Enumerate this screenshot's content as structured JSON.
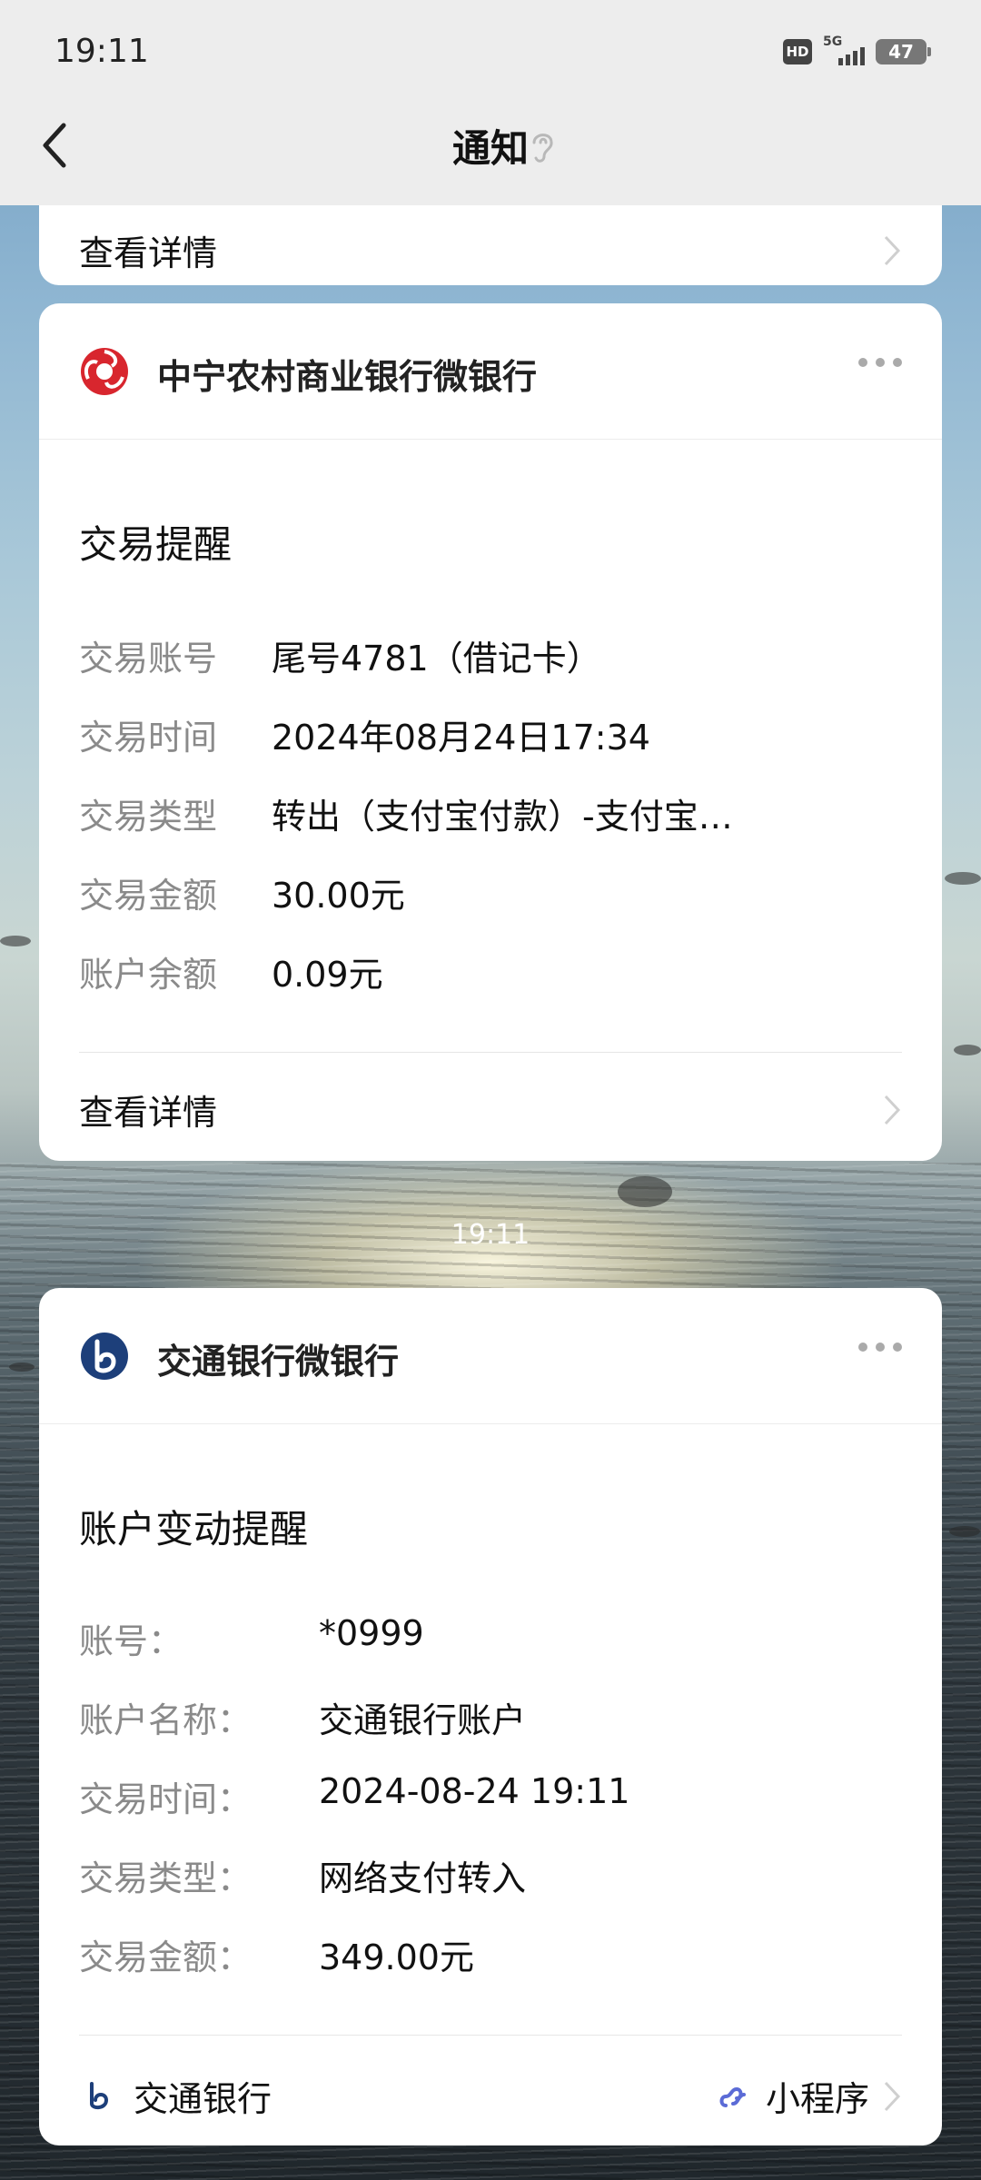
{
  "status_bar": {
    "time": "19:11",
    "hd": "HD",
    "network": "5G",
    "battery": "47"
  },
  "nav": {
    "title": "通知"
  },
  "top_card": {
    "detail_label": "查看详情"
  },
  "card1": {
    "bank_name": "中宁农村商业银行微银行",
    "title": "交易提醒",
    "rows": [
      {
        "key": "交易账号",
        "value": "尾号4781（借记卡）"
      },
      {
        "key": "交易时间",
        "value": "2024年08月24日17:34"
      },
      {
        "key": "交易类型",
        "value": "转出（支付宝付款）-支付宝…"
      },
      {
        "key": "交易金额",
        "value": "30.00元"
      },
      {
        "key": "账户余额",
        "value": "0.09元"
      }
    ],
    "detail_label": "查看详情",
    "logo_color": "#d8262e"
  },
  "time_separator": "19:11",
  "card2": {
    "bank_name": "交通银行微银行",
    "title": "账户变动提醒",
    "rows": [
      {
        "key": "账号：",
        "value": "*0999"
      },
      {
        "key": "账户名称：",
        "value": "交通银行账户"
      },
      {
        "key": "交易时间：",
        "value": "2024-08-24 19:11"
      },
      {
        "key": "交易类型：",
        "value": "网络支付转入"
      },
      {
        "key": "交易金额：",
        "value": "349.00元"
      }
    ],
    "footer_name": "交通银行",
    "mini_program_label": "小程序",
    "logo_color": "#1d3f7a"
  }
}
